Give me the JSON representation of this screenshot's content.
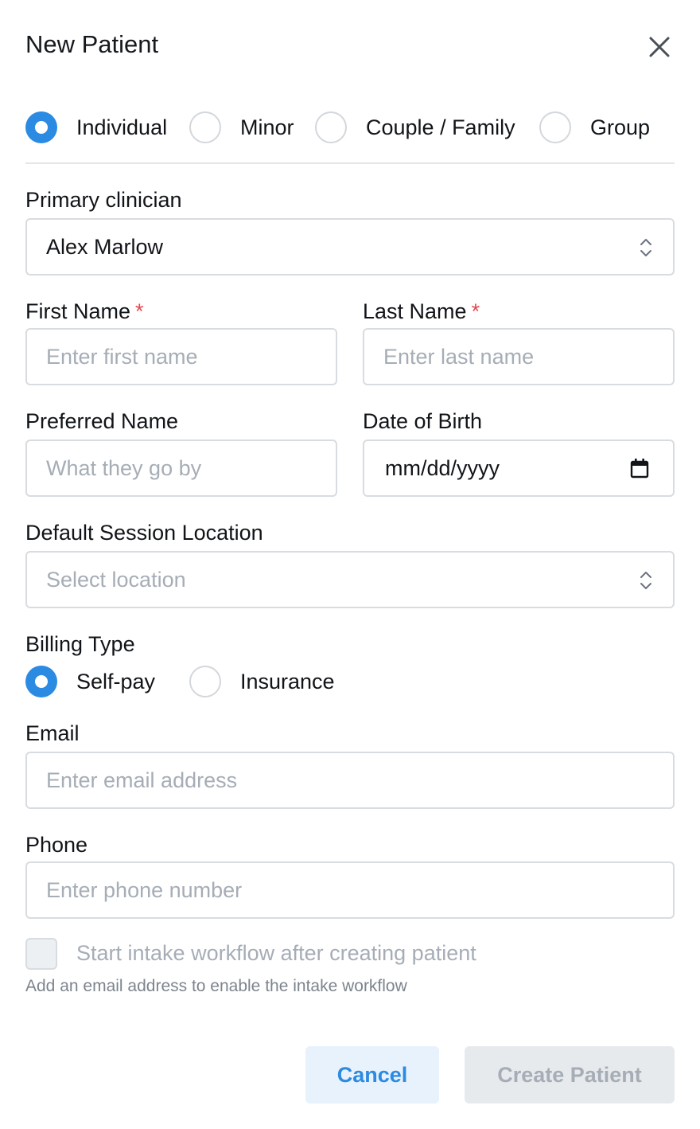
{
  "dialog": {
    "title": "New Patient"
  },
  "patient_types": [
    {
      "label": "Individual",
      "checked": true
    },
    {
      "label": "Minor",
      "checked": false
    },
    {
      "label": "Couple / Family",
      "checked": false
    },
    {
      "label": "Group",
      "checked": false
    }
  ],
  "primary_clinician": {
    "label": "Primary clinician",
    "value": "Alex Marlow"
  },
  "first_name": {
    "label": "First Name",
    "required_mark": "*",
    "placeholder": "Enter first name"
  },
  "last_name": {
    "label": "Last Name",
    "required_mark": "*",
    "placeholder": "Enter last name"
  },
  "preferred_name": {
    "label": "Preferred Name",
    "placeholder": "What they go by"
  },
  "date_of_birth": {
    "label": "Date of Birth",
    "value": "mm/dd/yyyy"
  },
  "session_location": {
    "label": "Default Session Location",
    "placeholder": "Select location"
  },
  "billing": {
    "label": "Billing Type",
    "options": [
      {
        "label": "Self-pay",
        "checked": true
      },
      {
        "label": "Insurance",
        "checked": false
      }
    ]
  },
  "email": {
    "label": "Email",
    "placeholder": "Enter email address"
  },
  "phone": {
    "label": "Phone",
    "placeholder": "Enter phone number"
  },
  "intake": {
    "label": "Start intake workflow after creating patient",
    "hint": "Add an email address to enable the intake workflow",
    "checked": false,
    "disabled": true
  },
  "actions": {
    "cancel_label": "Cancel",
    "create_label": "Create Patient"
  },
  "colors": {
    "accent": "#2b8ae2",
    "required": "#e5484d",
    "placeholder": "#a6adb6",
    "border": "#d8dce1",
    "disabled_button": "#e7eaed"
  }
}
